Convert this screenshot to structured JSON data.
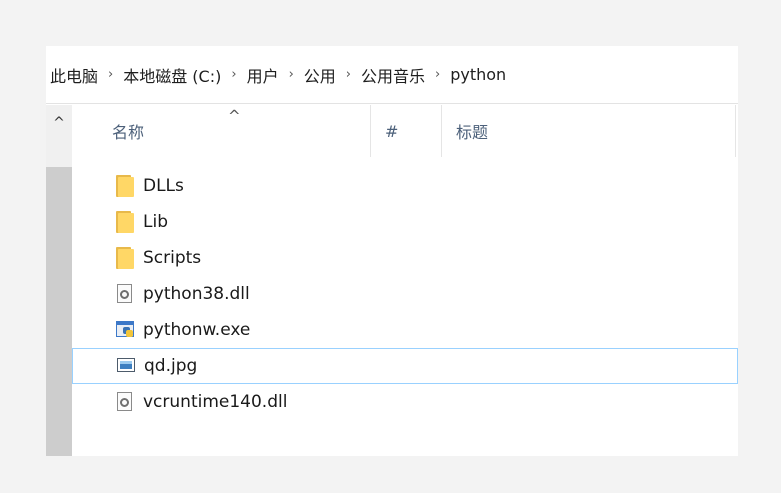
{
  "breadcrumb": {
    "items": [
      "此电脑",
      "本地磁盘 (C:)",
      "用户",
      "公用",
      "公用音乐",
      "python"
    ],
    "separator": "›"
  },
  "scrollbar": {
    "up_arrow": "^"
  },
  "header": {
    "sort_arrow": "^",
    "name_label": "名称",
    "number_label": "#",
    "title_label": "标题"
  },
  "files": [
    {
      "name": "DLLs",
      "icon": "folder-icon"
    },
    {
      "name": "Lib",
      "icon": "folder-icon"
    },
    {
      "name": "Scripts",
      "icon": "folder-icon"
    },
    {
      "name": "python38.dll",
      "icon": "dll-icon"
    },
    {
      "name": "pythonw.exe",
      "icon": "exe-icon"
    },
    {
      "name": "qd.jpg",
      "icon": "jpg-icon",
      "selected": true
    },
    {
      "name": "vcruntime140.dll",
      "icon": "dll-icon"
    }
  ],
  "colors": {
    "folder": "#ffd766",
    "selection_border": "#99d1ff",
    "header_text": "#4c607a",
    "scroll_thumb": "#cdcdcd"
  }
}
